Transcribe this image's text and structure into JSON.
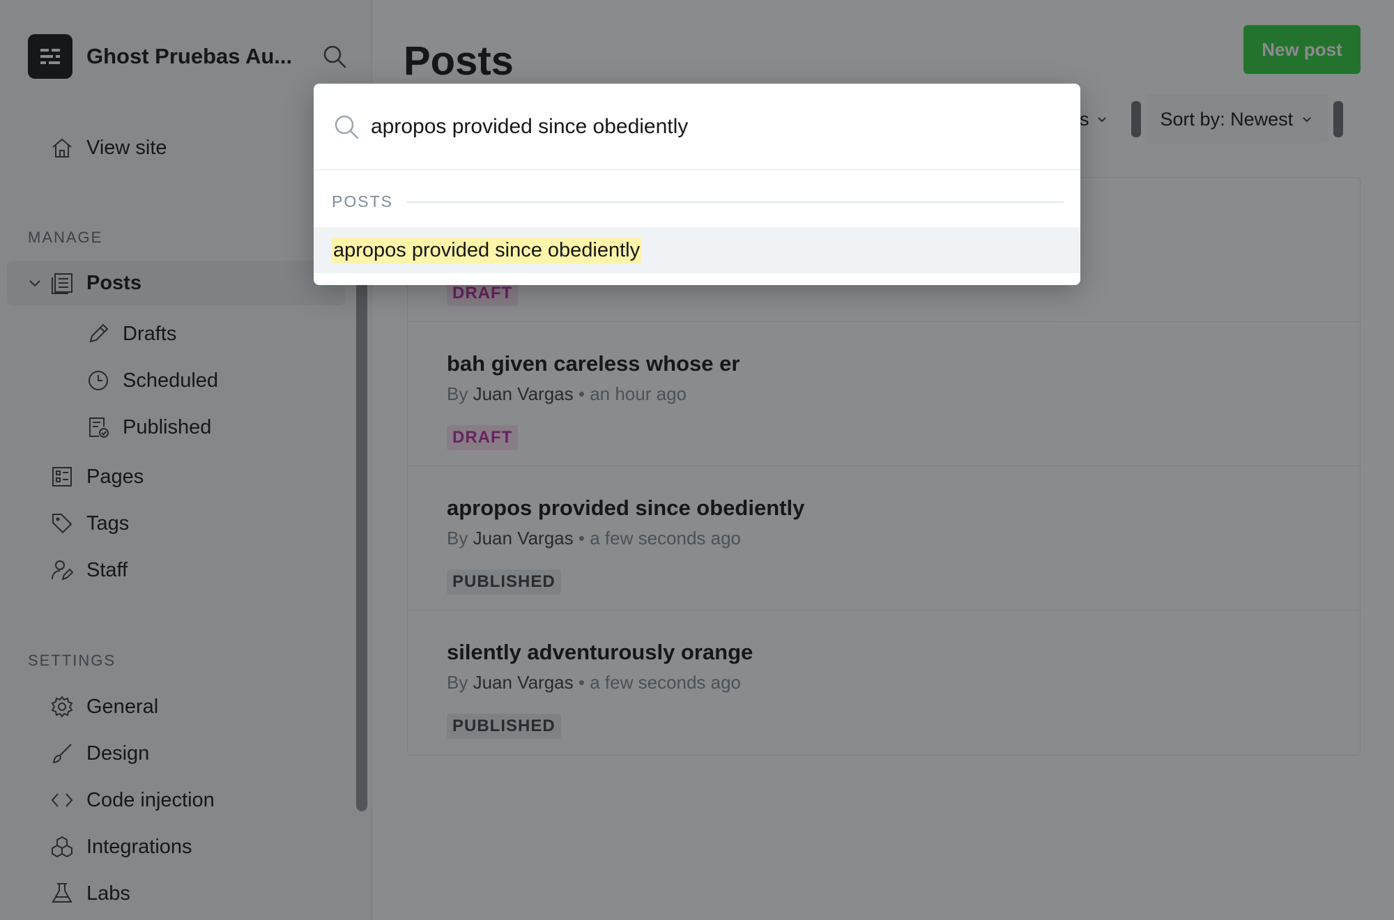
{
  "sidebar": {
    "site_title": "Ghost Pruebas Au...",
    "view_site": "View site",
    "manage_label": "MANAGE",
    "posts": "Posts",
    "drafts": "Drafts",
    "scheduled": "Scheduled",
    "published": "Published",
    "pages": "Pages",
    "tags": "Tags",
    "staff": "Staff",
    "settings_label": "SETTINGS",
    "general": "General",
    "design": "Design",
    "code_injection": "Code injection",
    "integrations": "Integrations",
    "labs": "Labs"
  },
  "main": {
    "title": "Posts",
    "new_post": "New post",
    "tags_filter": "gs",
    "sort": "Sort by: Newest",
    "posts": [
      {
        "title": "",
        "author": "",
        "time": "",
        "status": "DRAFT",
        "status_type": "draft"
      },
      {
        "title": "bah given careless whose er",
        "by": "By",
        "author": "Juan Vargas",
        "time": "an hour ago",
        "status": "DRAFT",
        "status_type": "draft"
      },
      {
        "title": "apropos provided since obediently",
        "by": "By",
        "author": "Juan Vargas",
        "time": "a few seconds ago",
        "status": "PUBLISHED",
        "status_type": "published"
      },
      {
        "title": "silently adventurously orange",
        "by": "By",
        "author": "Juan Vargas",
        "time": "a few seconds ago",
        "status": "PUBLISHED",
        "status_type": "published"
      }
    ]
  },
  "search_modal": {
    "query": "apropos provided since obediently",
    "section_label": "POSTS",
    "results": [
      "apropos provided since obediently"
    ]
  },
  "colors": {
    "accent_green": "#30cf43",
    "draft_pink": "#bd2ea0",
    "highlight_yellow": "#fff4a8"
  }
}
